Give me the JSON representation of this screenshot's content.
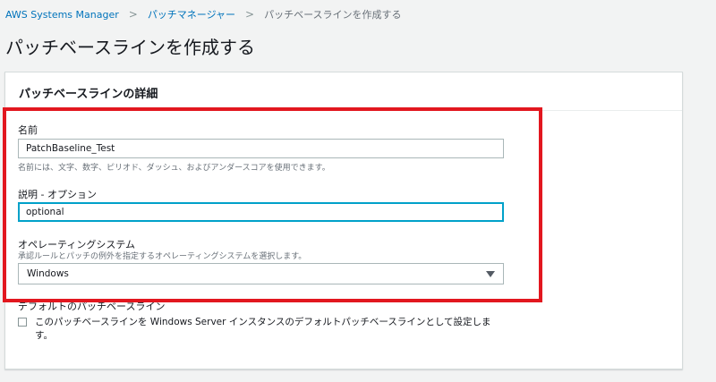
{
  "breadcrumb": {
    "items": [
      "AWS Systems Manager",
      "パッチマネージャー",
      "パッチベースラインを作成する"
    ],
    "separator": ">"
  },
  "page": {
    "title": "パッチベースラインを作成する"
  },
  "details": {
    "header": "パッチベースラインの詳細",
    "name": {
      "label": "名前",
      "value": "PatchBaseline_Test",
      "hint": "名前には、文字、数字、ピリオド、ダッシュ、およびアンダースコアを使用できます。"
    },
    "description": {
      "label": "説明 - オプション",
      "value": "optional"
    },
    "os": {
      "label": "オペレーティングシステム",
      "hint": "承認ルールとパッチの例外を指定するオペレーティングシステムを選択します。",
      "selected": "Windows"
    },
    "default_baseline": {
      "label": "デフォルトのパッチベースライン",
      "checkbox_text": "このパッチベースラインを Windows Server インスタンスのデフォルトパッチベースラインとして設定します。",
      "checked": false
    }
  },
  "colors": {
    "link": "#0073bb",
    "highlight_border": "#e2171f",
    "focus_border": "#00a1c9",
    "background": "#f2f3f3"
  }
}
